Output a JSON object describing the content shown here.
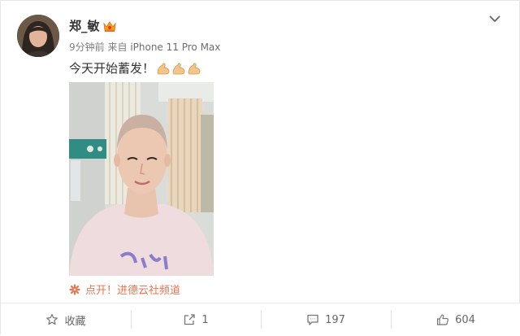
{
  "post": {
    "username": "郑_敏",
    "time": "9分钟前",
    "source_prefix": "来自",
    "source_device": "iPhone 11 Pro Max",
    "text": "今天开始蓄发！",
    "emoji_icon": "flexed-biceps-icon",
    "emoji_count": 3
  },
  "link": {
    "text": "点开！进德云社频道",
    "icon": "asterisk-flower-icon",
    "color": "#eb7350"
  },
  "actions": [
    {
      "label": "收藏",
      "icon": "star-outline-icon"
    },
    {
      "label": "1",
      "icon": "share-icon"
    },
    {
      "label": "197",
      "icon": "comment-icon"
    },
    {
      "label": "604",
      "icon": "thumbs-up-icon"
    }
  ],
  "colors": {
    "accent": "#eb7350",
    "meta_text": "#808080",
    "border": "#e6e6e6"
  }
}
